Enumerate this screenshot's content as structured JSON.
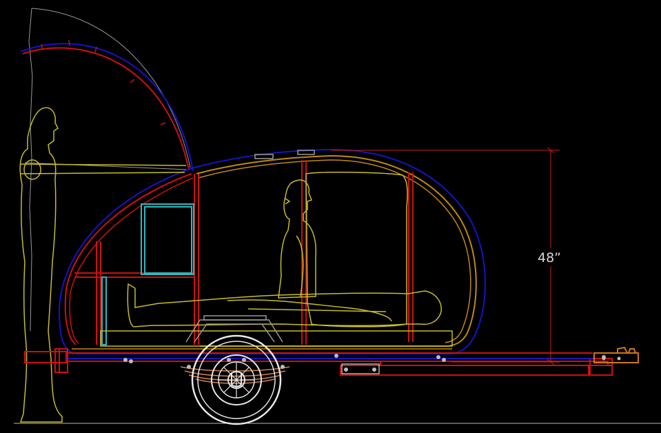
{
  "drawing": {
    "background": "#000000",
    "colors": {
      "shell_outer": "#1414c8",
      "shell_mid": "#d01010",
      "shell_inner": "#c08a10",
      "figure": "#c8be28",
      "cabinet": "#30b8c0",
      "frame": "#d01010",
      "wheel": "#e8e8e8",
      "spring": "#d08050",
      "hitch": "#d07818",
      "hatch_arc": "#9a9a9a",
      "dimension": "#c82020",
      "ground": "#bdbdbd"
    },
    "dimension_label": "48”",
    "icons": [
      "standing-person-icon",
      "seated-person-icon",
      "reclining-person-icon",
      "wheel-icon",
      "leaf-spring-icon",
      "hitch-icon"
    ]
  }
}
